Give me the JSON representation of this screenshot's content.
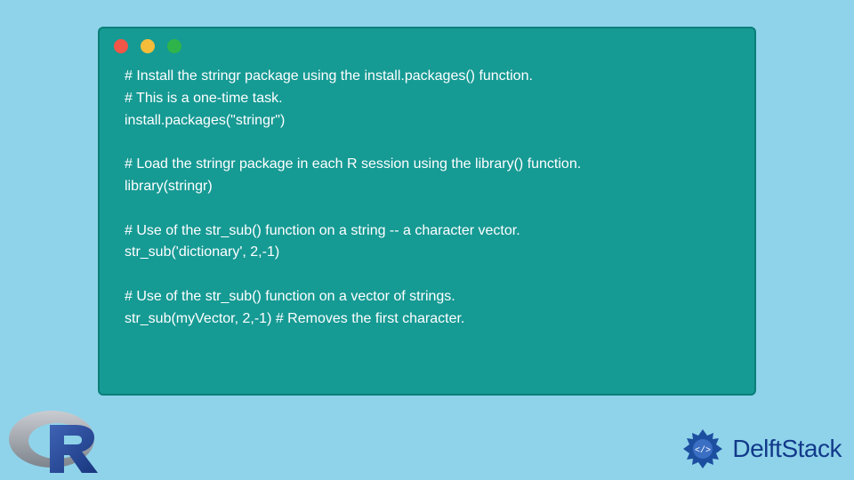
{
  "code": {
    "lines": [
      "# Install the stringr package using the install.packages() function.",
      "# This is a one-time task.",
      "install.packages(\"stringr\")",
      "",
      "# Load the stringr package in each R session using the library() function.",
      "library(stringr)",
      "",
      "# Use of the str_sub() function on a string -- a character vector.",
      "str_sub('dictionary', 2,-1)",
      "",
      "# Use of the str_sub() function on a vector of strings.",
      "str_sub(myVector, 2,-1) # Removes the first character."
    ]
  },
  "branding": {
    "site_name": "DelftStack"
  }
}
